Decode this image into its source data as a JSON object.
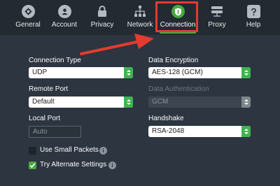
{
  "toolbar": {
    "tabs": [
      {
        "label": "General",
        "icon": "gear-icon"
      },
      {
        "label": "Account",
        "icon": "person-icon"
      },
      {
        "label": "Privacy",
        "icon": "lock-icon"
      },
      {
        "label": "Network",
        "icon": "network-icon"
      },
      {
        "label": "Connection",
        "icon": "connection-shield-icon",
        "active": true
      },
      {
        "label": "Proxy",
        "icon": "server-icon"
      },
      {
        "label": "Help",
        "icon": "question-icon"
      }
    ],
    "accent_color": "#4aa83f",
    "highlight_color": "#e53b2f"
  },
  "connection": {
    "connection_type": {
      "label": "Connection Type",
      "value": "UDP"
    },
    "remote_port": {
      "label": "Remote Port",
      "value": "Default"
    },
    "local_port": {
      "label": "Local Port",
      "placeholder": "Auto"
    },
    "data_encryption": {
      "label": "Data Encryption",
      "value": "AES-128 (GCM)"
    },
    "data_authentication": {
      "label": "Data Authentication",
      "value": "GCM",
      "disabled": true
    },
    "handshake": {
      "label": "Handshake",
      "value": "RSA-2048"
    },
    "use_small_packets": {
      "label": "Use Small Packets",
      "checked": false
    },
    "try_alternate_settings": {
      "label": "Try Alternate Settings",
      "checked": true
    },
    "info_icon_glyph": "i"
  }
}
